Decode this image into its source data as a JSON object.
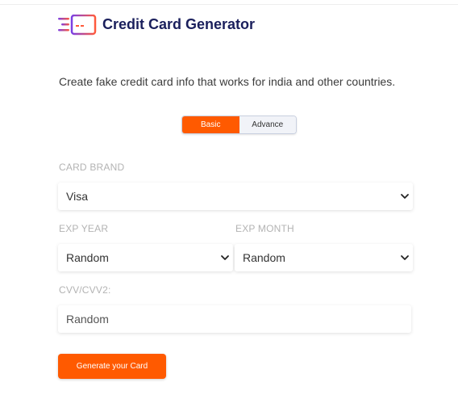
{
  "header": {
    "title": "Credit Card Generator",
    "logo_icon": "credit-card-icon"
  },
  "subtitle": "Create fake credit card info that works for india and other countries.",
  "mode_toggle": {
    "tabs": [
      {
        "label": "Basic",
        "active": true
      },
      {
        "label": "Advance",
        "active": false
      }
    ]
  },
  "form": {
    "card_brand": {
      "label": "CARD BRAND",
      "value": "Visa"
    },
    "exp_year": {
      "label": "EXP YEAR",
      "value": "Random"
    },
    "exp_month": {
      "label": "EXP MONTH",
      "value": "Random"
    },
    "cvv": {
      "label": "CVV/CVV2:",
      "placeholder": "Random"
    }
  },
  "generate_button": {
    "label": "Generate your Card"
  },
  "colors": {
    "accent": "#ff5a00",
    "title": "#1a1f5c",
    "logo_gradient_start": "#7b3fe4",
    "logo_gradient_end": "#ff5a3c"
  }
}
